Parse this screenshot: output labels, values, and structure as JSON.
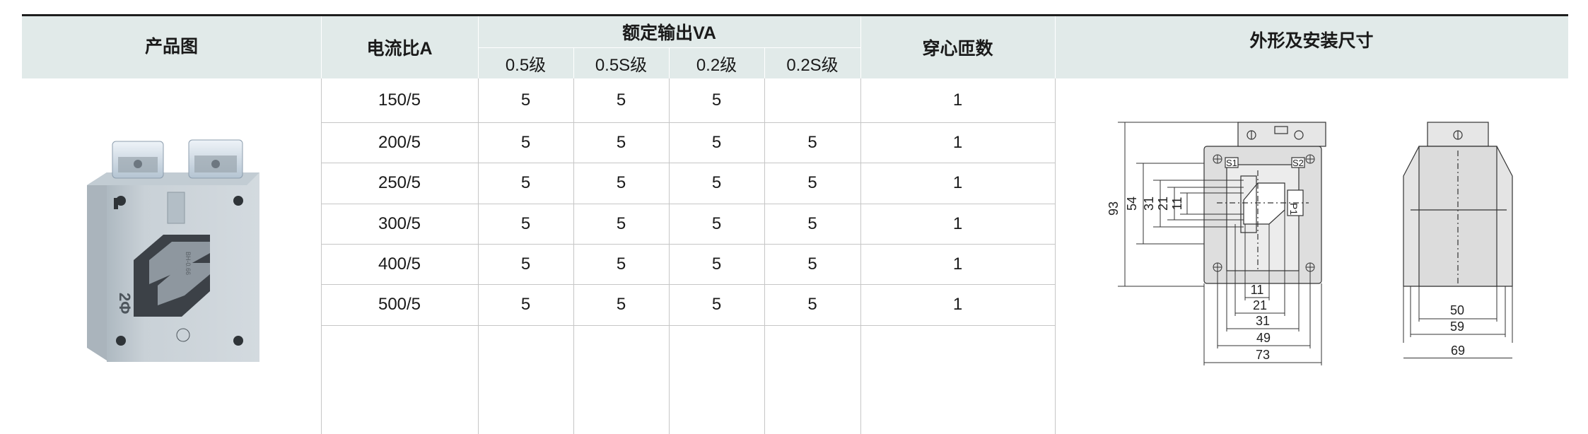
{
  "header": {
    "product_image": "产品图",
    "current_ratio": "电流比A",
    "rated_output": "额定输出VA",
    "classes": [
      "0.5级",
      "0.5S级",
      "0.2级",
      "0.2S级"
    ],
    "turns": "穿心匝数",
    "dimensions": "外形及安装尺寸"
  },
  "rows": [
    {
      "ratio": "150/5",
      "c05": "5",
      "c05s": "5",
      "c02": "5",
      "c02s": "",
      "turns": "1"
    },
    {
      "ratio": "200/5",
      "c05": "5",
      "c05s": "5",
      "c02": "5",
      "c02s": "5",
      "turns": "1"
    },
    {
      "ratio": "250/5",
      "c05": "5",
      "c05s": "5",
      "c02": "5",
      "c02s": "5",
      "turns": "1"
    },
    {
      "ratio": "300/5",
      "c05": "5",
      "c05s": "5",
      "c02": "5",
      "c02s": "5",
      "turns": "1"
    },
    {
      "ratio": "400/5",
      "c05": "5",
      "c05s": "5",
      "c02": "5",
      "c02s": "5",
      "turns": "1"
    },
    {
      "ratio": "500/5",
      "c05": "5",
      "c05s": "5",
      "c02": "5",
      "c02s": "5",
      "turns": "1"
    }
  ],
  "product_photo": {
    "model_mark": "BH-0.66",
    "side_mark": "2Φ"
  },
  "front_view": {
    "height_labels": [
      "93",
      "54",
      "31",
      "21",
      "11"
    ],
    "width_labels": [
      "11",
      "21",
      "31",
      "49",
      "73"
    ],
    "terminals": [
      "S1",
      "S2"
    ],
    "primary": "P1"
  },
  "side_view": {
    "width_labels": [
      "50",
      "59",
      "69"
    ]
  }
}
